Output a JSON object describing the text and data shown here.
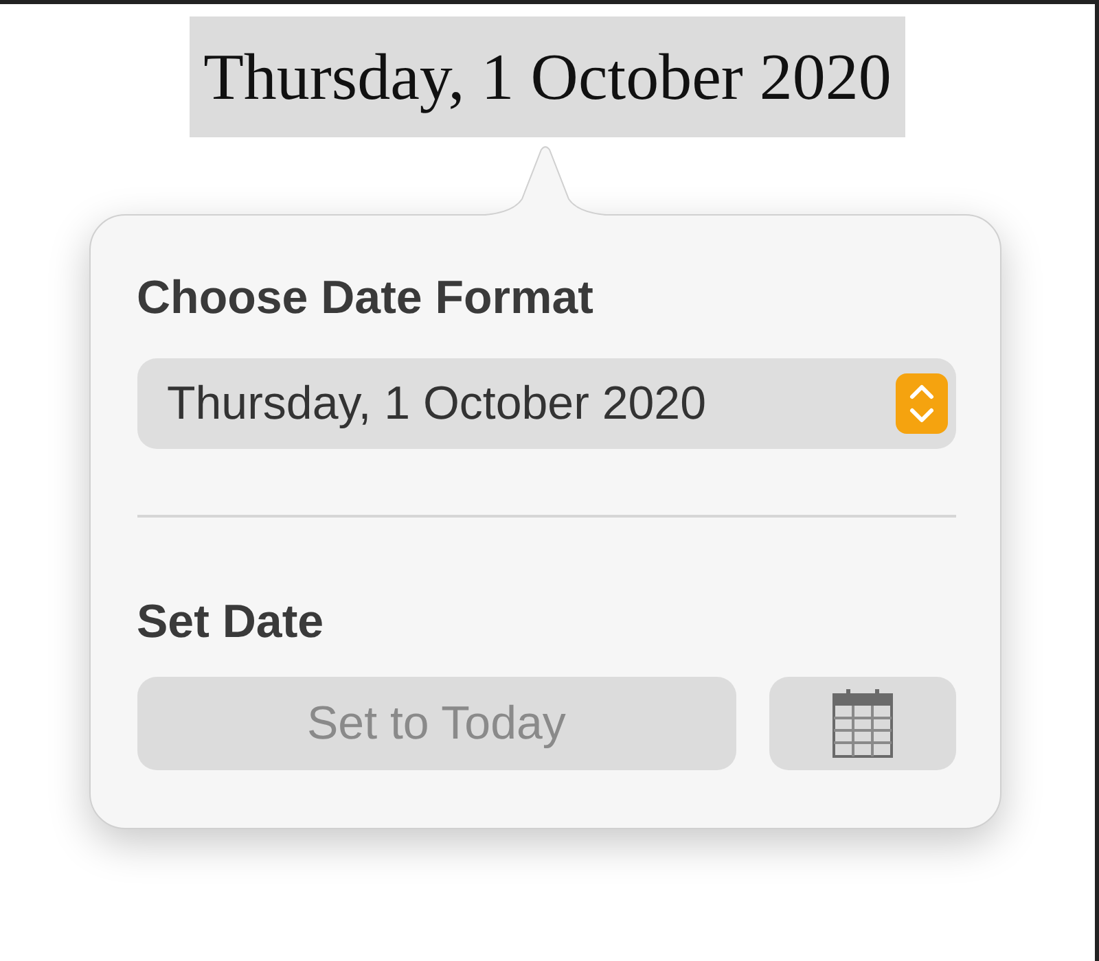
{
  "document": {
    "date_text": "Thursday, 1 October 2020",
    "selected": true
  },
  "popover": {
    "format_heading": "Choose Date Format",
    "format_select": {
      "value": "Thursday, 1 October 2020"
    },
    "set_heading": "Set Date",
    "today_button": {
      "label": "Set to Today",
      "disabled": true
    }
  }
}
